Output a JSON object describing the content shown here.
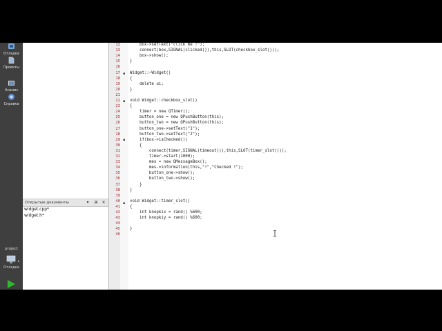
{
  "modes": [
    {
      "label": "Отладка",
      "icon": "bug-icon"
    },
    {
      "label": "Проекты",
      "icon": "projects-icon"
    },
    {
      "label": "Анализ",
      "icon": "analyze-icon"
    },
    {
      "label": "Справка",
      "icon": "help-icon"
    }
  ],
  "project": {
    "name": "project",
    "mode_label": "Отладка"
  },
  "open_docs": {
    "title": "Открытые документы",
    "items": [
      "widget.cpp*",
      "widget.h*"
    ]
  },
  "editor": {
    "lines": [
      {
        "n": "12",
        "text": "    box->setText(\"click me !\");"
      },
      {
        "n": "13",
        "text": "    connect(box,SIGNAL(clicked()),this,SLOT(checkbox_slot()));"
      },
      {
        "n": "14",
        "text": "    box->show();"
      },
      {
        "n": "15",
        "text": "}"
      },
      {
        "n": "16",
        "text": ""
      },
      {
        "n": "17",
        "text": "Widget::~Widget()"
      },
      {
        "n": "18",
        "text": "{"
      },
      {
        "n": "19",
        "text": "    delete ui;"
      },
      {
        "n": "20",
        "text": "}"
      },
      {
        "n": "21",
        "text": ""
      },
      {
        "n": "22",
        "text": "void Widget::checkbox_slot()"
      },
      {
        "n": "23",
        "text": "{"
      },
      {
        "n": "24",
        "text": "    timer = new QTimer();"
      },
      {
        "n": "25",
        "text": "    button_one = new QPushButton(this);"
      },
      {
        "n": "26",
        "text": "    button_two = new QPushButton(this);"
      },
      {
        "n": "27",
        "text": "    button_one->setText(\"1\");"
      },
      {
        "n": "28",
        "text": "    button_two->setText(\"2\");"
      },
      {
        "n": "29",
        "text": "    if(box->isChecked())"
      },
      {
        "n": "30",
        "text": "    {"
      },
      {
        "n": "31",
        "text": "        connect(timer,SIGNAL(timeout()),this,SLOT(timer_slot()));"
      },
      {
        "n": "32",
        "text": "        timer->start(1000);"
      },
      {
        "n": "33",
        "text": "        mes = new QMessageBox();"
      },
      {
        "n": "34",
        "text": "        mes->information(this,\"!\",\"Checked !\");"
      },
      {
        "n": "35",
        "text": "        button_one->show();"
      },
      {
        "n": "36",
        "text": "        button_two->show();"
      },
      {
        "n": "37",
        "text": "    }"
      },
      {
        "n": "38",
        "text": "}"
      },
      {
        "n": "39",
        "text": ""
      },
      {
        "n": "40",
        "text": "void Widget::timer_slot()"
      },
      {
        "n": "41",
        "text": "{"
      },
      {
        "n": "42",
        "text": "    int knopkix = rand() %600;"
      },
      {
        "n": "43",
        "text": "    int knopkiy = rand() %600;"
      },
      {
        "n": "44",
        "text": ""
      },
      {
        "n": "45",
        "text": "}"
      },
      {
        "n": "46",
        "text": ""
      }
    ]
  },
  "colors": {
    "background": "#000000",
    "modebar": "#3f3f3f",
    "run_green": "#2dbb2d",
    "line_number": "#a03030"
  }
}
